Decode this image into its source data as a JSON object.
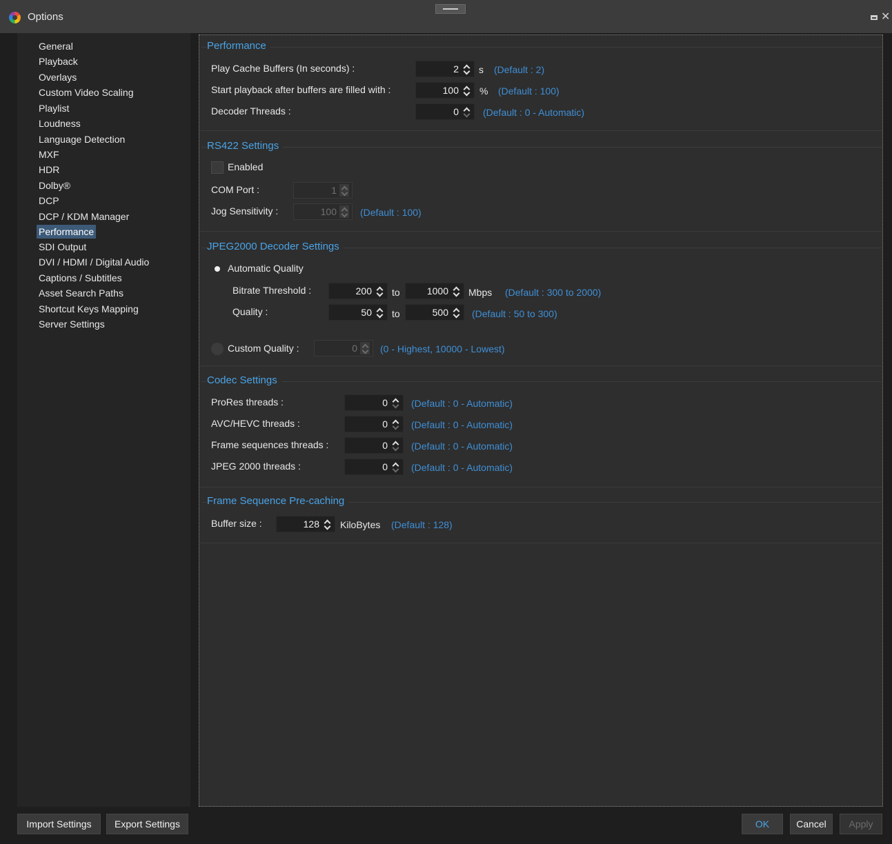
{
  "window": {
    "title": "Options"
  },
  "sidebar": {
    "items": [
      {
        "label": "General"
      },
      {
        "label": "Playback"
      },
      {
        "label": "Overlays"
      },
      {
        "label": "Custom Video Scaling"
      },
      {
        "label": "Playlist"
      },
      {
        "label": "Loudness"
      },
      {
        "label": "Language Detection"
      },
      {
        "label": "MXF"
      },
      {
        "label": "HDR"
      },
      {
        "label": "Dolby®"
      },
      {
        "label": "DCP"
      },
      {
        "label": "DCP / KDM Manager"
      },
      {
        "label": "Performance"
      },
      {
        "label": "SDI Output"
      },
      {
        "label": "DVI / HDMI / Digital Audio"
      },
      {
        "label": "Captions / Subtitles"
      },
      {
        "label": "Asset Search Paths"
      },
      {
        "label": "Shortcut Keys Mapping"
      },
      {
        "label": "Server Settings"
      }
    ],
    "selected": "Performance"
  },
  "performance": {
    "title": "Performance",
    "cache_label": "Play Cache Buffers (In seconds) :",
    "cache_value": "2",
    "cache_unit": "s",
    "cache_hint": "(Default : 2)",
    "start_label": "Start playback after buffers are filled with :",
    "start_value": "100",
    "start_unit": "%",
    "start_hint": "(Default : 100)",
    "decoder_label": "Decoder Threads :",
    "decoder_value": "0",
    "decoder_hint": "(Default : 0 - Automatic)"
  },
  "rs422": {
    "title": "RS422 Settings",
    "enabled_label": "Enabled",
    "enabled_checked": false,
    "com_label": "COM Port :",
    "com_value": "1",
    "jog_label": "Jog Sensitivity :",
    "jog_value": "100",
    "jog_hint": "(Default : 100)"
  },
  "jpeg2000": {
    "title": "JPEG2000 Decoder Settings",
    "auto_label": "Automatic Quality",
    "auto_selected": true,
    "bitrate_label": "Bitrate Threshold :",
    "bitrate_min": "200",
    "bitrate_to": "to",
    "bitrate_max": "1000",
    "bitrate_unit": "Mbps",
    "bitrate_hint": "(Default : 300 to 2000)",
    "quality_label": "Quality :",
    "quality_min": "50",
    "quality_to": "to",
    "quality_max": "500",
    "quality_hint": "(Default : 50 to 300)",
    "custom_label": "Custom Quality :",
    "custom_value": "0",
    "custom_hint": "(0 - Highest,  10000 - Lowest)"
  },
  "codec": {
    "title": "Codec Settings",
    "rows": [
      {
        "label": "ProRes threads :",
        "value": "0",
        "hint": "(Default : 0 - Automatic)"
      },
      {
        "label": "AVC/HEVC threads :",
        "value": "0",
        "hint": "(Default : 0 - Automatic)"
      },
      {
        "label": "Frame sequences threads :",
        "value": "0",
        "hint": "(Default : 0 - Automatic)"
      },
      {
        "label": "JPEG 2000 threads :",
        "value": "0",
        "hint": "(Default : 0 - Automatic)"
      }
    ]
  },
  "precache": {
    "title": "Frame Sequence Pre-caching",
    "buffer_label": "Buffer size :",
    "buffer_value": "128",
    "buffer_unit": "KiloBytes",
    "buffer_hint": "(Default : 128)"
  },
  "footer": {
    "import_label": "Import Settings",
    "export_label": "Export Settings",
    "ok_label": "OK",
    "cancel_label": "Cancel",
    "apply_label": "Apply"
  },
  "colors": {
    "accent": "#4aa3e6",
    "hint": "#3f8fd6",
    "selection": "#3d5a78"
  }
}
